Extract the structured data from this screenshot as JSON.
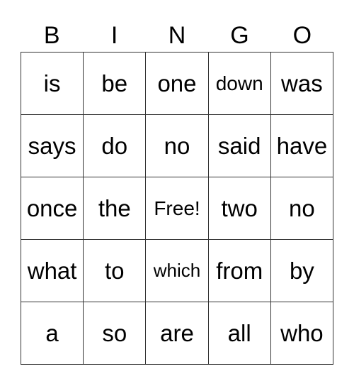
{
  "header": [
    "B",
    "I",
    "N",
    "G",
    "O"
  ],
  "cells": [
    [
      "is",
      "be",
      "one",
      "down",
      "was"
    ],
    [
      "says",
      "do",
      "no",
      "said",
      "have"
    ],
    [
      "once",
      "the",
      "Free!",
      "two",
      "no"
    ],
    [
      "what",
      "to",
      "which",
      "from",
      "by"
    ],
    [
      "a",
      "so",
      "are",
      "all",
      "who"
    ]
  ]
}
